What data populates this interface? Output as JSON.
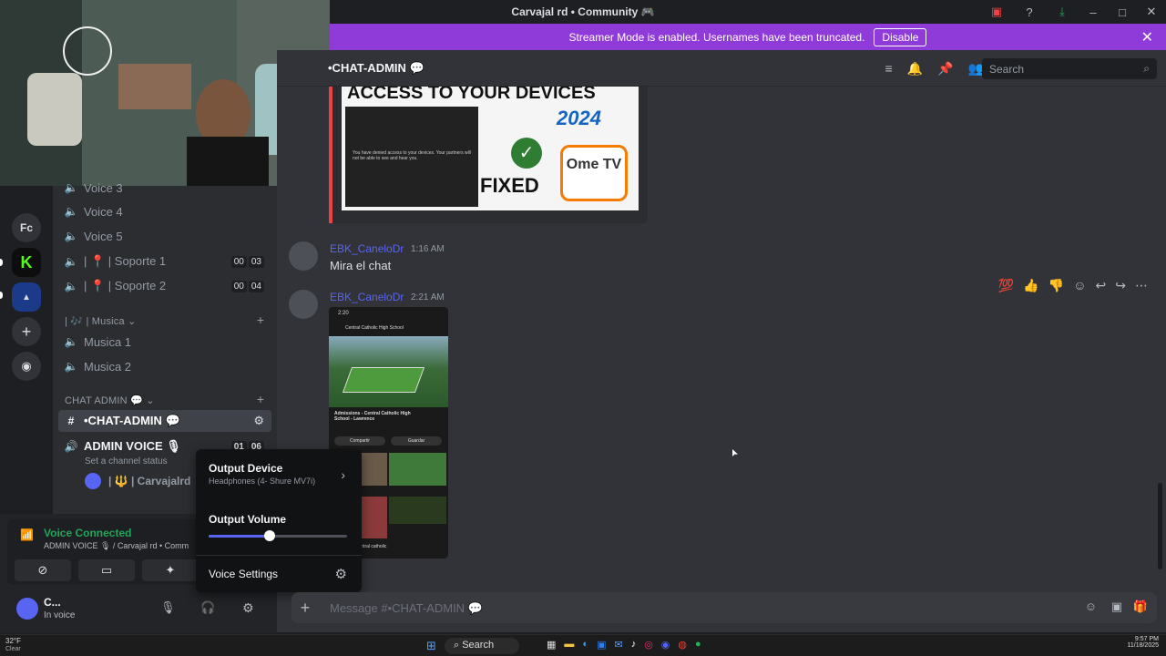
{
  "titlebar": {
    "title": "Carvajal rd • Community 🎮"
  },
  "streamer": {
    "text": "Streamer Mode is enabled. Usernames have been truncated.",
    "disable": "Disable"
  },
  "servers": {
    "fc": "Fc"
  },
  "channels": [
    {
      "label": "Voice 3",
      "icon": "speaker-icon"
    },
    {
      "label": "Voice 4",
      "icon": "speaker-icon"
    },
    {
      "label": "Voice 5",
      "icon": "speaker-icon"
    },
    {
      "label": "| 📍 | Soporte 1",
      "count_a": "00",
      "count_b": "03"
    },
    {
      "label": "| 📍 | Soporte 2",
      "count_a": "00",
      "count_b": "04"
    }
  ],
  "category_musica": "| 🎶 | Musica",
  "musica": [
    "Musica 1",
    "Musica 2"
  ],
  "category_admin": "CHAT ADMIN 💬",
  "chat_admin_channel": "•CHAT-ADMIN 💬",
  "admin_voice": {
    "label": "ADMIN VOICE 🎙",
    "count_a": "01",
    "count_b": "06",
    "status": "Set a channel status"
  },
  "voice_member": "| 🔱 | Carvajalrd",
  "voice": {
    "connected": "Voice Connected",
    "where": "ADMIN VOICE 🎙 / Carvajal rd • Comm"
  },
  "user": {
    "name": "C...",
    "status": "In voice"
  },
  "header": {
    "channel": "•CHAT-ADMIN 💬",
    "search": "Search"
  },
  "embed": {
    "line1": "ACCESS TO YOUR DEVICES",
    "year": "2024",
    "fixed": "FIXED",
    "brand": "Ome TV",
    "sub": "You have denied access to your devices. Your partners will not be able to see and hear you."
  },
  "messages": [
    {
      "user": "EBK_CaneloDr",
      "time": "1:16 AM",
      "text": "Mira el chat"
    },
    {
      "user": "EBK_CaneloDr",
      "time": "2:21 AM",
      "text": ""
    }
  ],
  "phone": {
    "time": "2:20",
    "site": "Central Catholic High School",
    "title": "Admissions - Central Catholic High School - Lawrence",
    "btn1": "Compartir",
    "btn2": "Guardar",
    "search": "central catholic"
  },
  "popup": {
    "output_device": "Output Device",
    "device_name": "Headphones (4- Shure MV7i)",
    "output_volume": "Output Volume",
    "volume": 0.44,
    "voice_settings": "Voice Settings"
  },
  "composer": {
    "placeholder": "Message #•CHAT-ADMIN 💬"
  },
  "taskbar": {
    "weather": "32°F",
    "weather_sub": "Clear",
    "search": "Search",
    "time": "9:57 PM",
    "date": "11/18/2025"
  },
  "colors": {
    "streamer": "#8f3bd9",
    "accent": "#5865f2",
    "green": "#23a55a"
  }
}
